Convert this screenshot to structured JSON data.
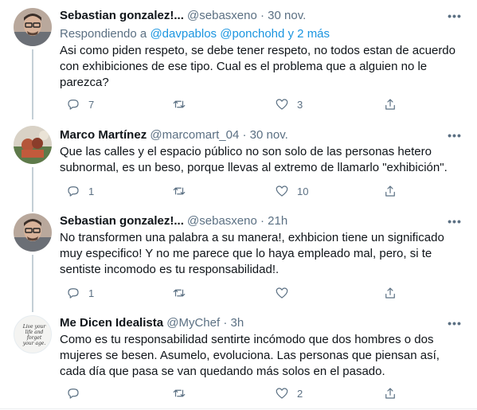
{
  "tweets": [
    {
      "name": "Sebastian gonzalez!...",
      "handle": "@sebasxeno",
      "dot": "·",
      "time": "30 nov.",
      "replying_prefix": "Respondiendo a ",
      "replying_mentions": "@davpablos @ponchohd",
      "replying_suffix": " y 2 más",
      "text": "Asi como piden respeto, se debe tener respeto, no todos estan de acuerdo con exhibiciones de ese tipo. Cual es el problema que a alguien no le parezca?",
      "replies": "7",
      "retweets": "",
      "likes": "3",
      "more": "•••"
    },
    {
      "name": "Marco Martínez",
      "handle": "@marcomart_04",
      "dot": "·",
      "time": "30 nov.",
      "text": "Que las calles y el espacio público no son solo de las personas hetero subnormal, es un beso, porque llevas al extremo de llamarlo \"exhibición\".",
      "replies": "1",
      "retweets": "",
      "likes": "10",
      "more": "•••"
    },
    {
      "name": "Sebastian gonzalez!...",
      "handle": "@sebasxeno",
      "dot": "·",
      "time": "21h",
      "text": "No transformen una palabra a su manera!, exhbicion tiene un significado muy especifico! Y no me parece que lo haya empleado mal, pero, si te sentiste incomodo es tu responsabilidad!.",
      "replies": "1",
      "retweets": "",
      "likes": "",
      "more": "•••"
    },
    {
      "name": "Me Dicen Idealista",
      "handle": "@MyChef",
      "dot": "·",
      "time": "3h",
      "text": "Como es tu responsabilidad sentirte incómodo que dos hombres o dos mujeres se besen. Asumelo, evoluciona. Las personas que piensan así, cada día que pasa se van quedando más solos en el pasado.",
      "replies": "",
      "retweets": "",
      "likes": "2",
      "more": "•••",
      "avatar_text": "Live your life and forget your age."
    }
  ],
  "colors": {
    "secondary": "#5b7083",
    "link": "#1b95e0",
    "thread_line": "#c4cfd6"
  }
}
